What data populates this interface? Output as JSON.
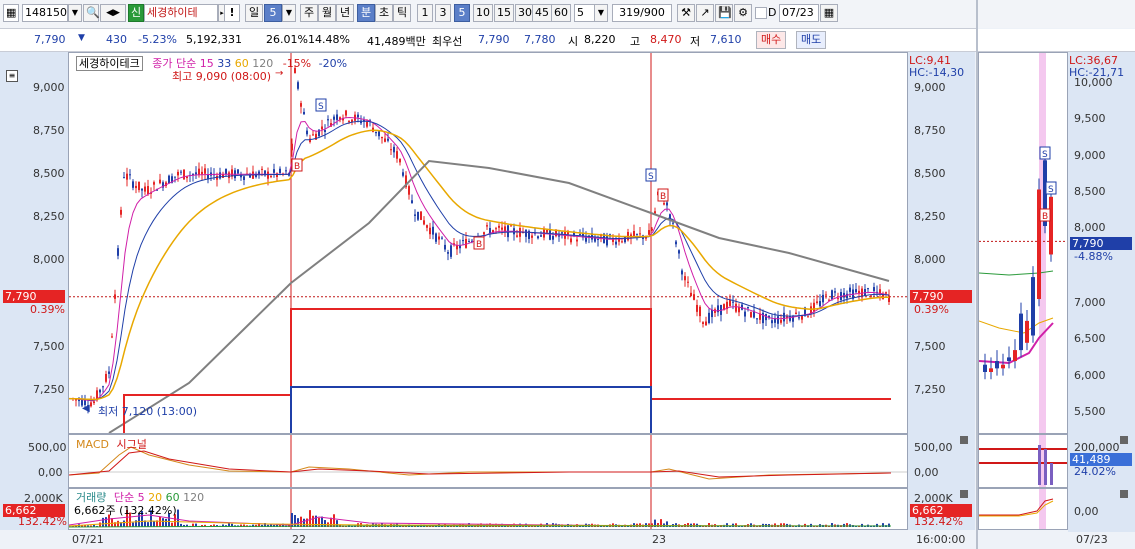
{
  "toolbar": {
    "code": "148150",
    "new_badge": "신",
    "stock_name": "세경하이테",
    "warn": "!",
    "period_day": "일",
    "period_num": "5",
    "week": "주",
    "month": "월",
    "year": "년",
    "minute": "분",
    "second": "초",
    "tick": "틱",
    "n1": "1",
    "n3": "3",
    "n5": "5",
    "n10": "10",
    "n15": "15",
    "n30": "30",
    "n45": "45",
    "n60": "60",
    "count": "5",
    "range": "319/900",
    "d_label": "D",
    "date": "07/23"
  },
  "quote": {
    "price": "7,790",
    "change": "430",
    "change_pct": "-5.23%",
    "volume": "5,192,331",
    "vol_rate": "26.01%",
    "turnover": "14.48%",
    "amount": "41,489백만",
    "best_label": "최우선",
    "bid_best": "7,790",
    "ask_best": "7,780",
    "open_label": "시",
    "open": "8,220",
    "high_label": "고",
    "high": "8,470",
    "low_label": "저",
    "low": "7,610",
    "buy": "매수",
    "sell": "매도"
  },
  "main": {
    "legend_name": "세경하이테크",
    "ma_label": "종가 단순",
    "ma1": "15",
    "ma2": "33",
    "ma3": "60",
    "ma4": "120",
    "env1": "-15%",
    "env2": "-20%",
    "high_note": "최고 9,090 (08:00)",
    "low_note": "최저 7,120 (13:00)",
    "lc": "LC:9,41",
    "hc": "HC:-14,30",
    "ticks": [
      "9,000",
      "8,750",
      "8,500",
      "8,250",
      "8,000",
      "7,500",
      "7,250"
    ],
    "cur_price": "7,790",
    "cur_pct": "0.39%",
    "dates": [
      "07/21",
      "22",
      "23"
    ],
    "time": "16:00:00"
  },
  "macd": {
    "label1": "MACD",
    "label2": "시그널",
    "ticks": [
      "500,00",
      "0,00"
    ]
  },
  "volume": {
    "label": "거래량",
    "ma_label": "단순",
    "ma1": "5",
    "ma2": "20",
    "ma3": "60",
    "ma4": "120",
    "vol_note": "6,662주 (132.42%)",
    "tick": "2,000K",
    "cur": "6,662",
    "cur_pct": "132.42%"
  },
  "side": {
    "lc": "LC:36,67",
    "hc": "HC:-21,71",
    "ticks": [
      "10,000",
      "9,500",
      "9,000",
      "8,500",
      "8,000",
      "7,000",
      "6,500",
      "6,000",
      "5,500"
    ],
    "cur_price": "7,790",
    "cur_pct": "-4.88%",
    "vol_ticks": [
      "200,000",
      "0,00"
    ],
    "vol_cur": "41,489",
    "vol_pct": "24.02%",
    "date": "07/23"
  },
  "colors": {
    "up": "#e52424",
    "down": "#1f3fa8",
    "ma15": "#d01fa8",
    "ma33": "#1f3fa8",
    "ma60": "#e8a800",
    "ma120": "#808080"
  }
}
